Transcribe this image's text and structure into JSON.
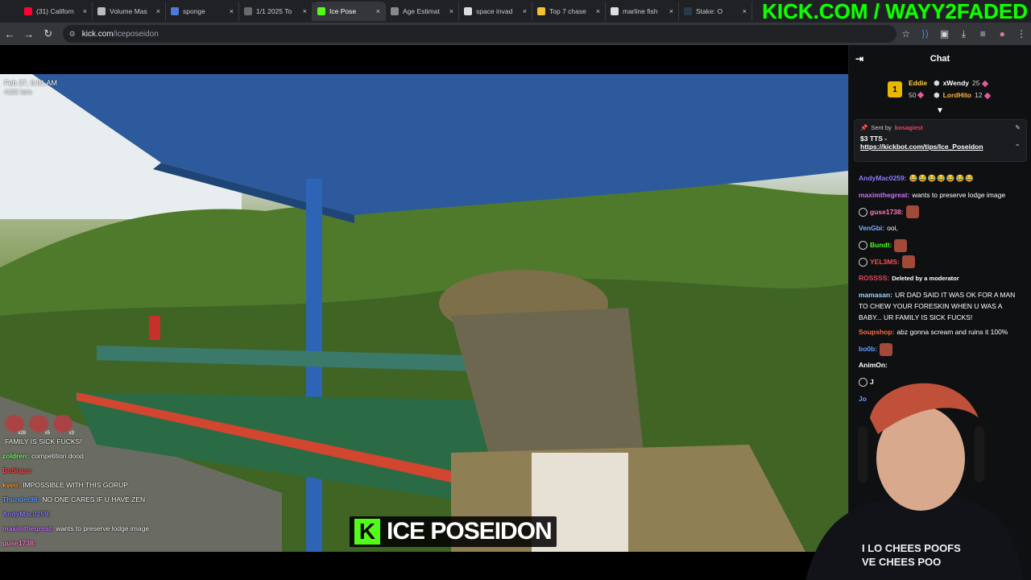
{
  "browser": {
    "tabs": [
      {
        "label": "(31) Californ",
        "color": "#ff0033",
        "active": false
      },
      {
        "label": "Volume Mas",
        "color": "#bbbbbb",
        "active": false
      },
      {
        "label": "sponge",
        "color": "#4a7bd9",
        "active": false
      },
      {
        "label": "1/1 2025 To",
        "color": "#6a6a6a",
        "active": false
      },
      {
        "label": "Ice Pose",
        "color": "#53fc18",
        "active": true
      },
      {
        "label": "Age Estimat",
        "color": "#888888",
        "active": false
      },
      {
        "label": "space invad",
        "color": "#dddddd",
        "active": false
      },
      {
        "label": "Top 7 chase",
        "color": "#f1c232",
        "active": false
      },
      {
        "label": "marline fish",
        "color": "#dddddd",
        "active": false
      },
      {
        "label": "Stake: O",
        "color": "#2a3a4a",
        "active": false
      }
    ],
    "tab_close_glyph": "×",
    "url_host": "kick.com",
    "url_path": "/iceposeidon"
  },
  "stream_overlay_text": "KICK.COM / WAYY2FADED",
  "player": {
    "timestamp": "Feb 27, 6:01 AM",
    "bitrate": "4192 kb/s",
    "streamer_badge_letter": "K",
    "streamer_badge_name": "ICE POSEIDON",
    "overlay_emote_counts": [
      "x28",
      "x5",
      "x3"
    ],
    "overlay_chat": [
      {
        "user": "",
        "color": "#ffffff",
        "text": "FAMILY IS SICK FUCKS!"
      },
      {
        "user": "zoldren:",
        "color": "#7cff6b",
        "text": "competition dood"
      },
      {
        "user": "BoSlaps:",
        "color": "#ff4e4e",
        "text": ""
      },
      {
        "user": "kveo:",
        "color": "#ff9d3b",
        "text": "IMPOSSIBLE WITH THIS GORUP"
      },
      {
        "user": "Thunder98:",
        "color": "#5fa0ff",
        "text": "NO ONE CARES IF U HAVE ZEN"
      },
      {
        "user": "AndyMac0259:",
        "color": "#8c7cff",
        "text": ""
      },
      {
        "user": "maximthegreat:",
        "color": "#c872ff",
        "text": "wants to preserve lodge image"
      },
      {
        "user": "guse1738:",
        "color": "#ff79c6",
        "text": ""
      }
    ]
  },
  "chat": {
    "header_title": "Chat",
    "leaderboard": {
      "rank": "1",
      "first_name": "Eddie",
      "first_value": "50",
      "others": [
        {
          "name": "xWendy",
          "value": "25",
          "color": "#ffffff"
        },
        {
          "name": "LordHito",
          "value": "12",
          "color": "#ffb347"
        }
      ]
    },
    "pinned": {
      "sent_by_label": "Sent by",
      "sender": "bosagiest",
      "tts_line": "$3 TTS -",
      "link": "https://kickbot.com/tips/Ice_Poseidon"
    },
    "messages": [
      {
        "user": "AndyMac0259:",
        "color": "#8c7cff",
        "text": "",
        "emojis": "😂😂😂😂😂😂😂",
        "badge": false,
        "emote": false
      },
      {
        "user": "maximthegreat:",
        "color": "#c872ff",
        "text": "wants to preserve lodge image",
        "emojis": "",
        "badge": false,
        "emote": false
      },
      {
        "user": "guse1738:",
        "color": "#ff79c6",
        "text": "",
        "emojis": "",
        "badge": true,
        "emote": true
      },
      {
        "user": "VenGbi:",
        "color": "#7fb0ff",
        "text": "ooi,",
        "emojis": "",
        "badge": false,
        "emote": false
      },
      {
        "user": "Bundt:",
        "color": "#53fc18",
        "text": "",
        "emojis": "",
        "badge": true,
        "emote": true
      },
      {
        "user": "YEL3MS:",
        "color": "#ff4e4e",
        "text": "",
        "emojis": "",
        "badge": true,
        "emote": true
      },
      {
        "user": "ROSSSS:",
        "color": "#e8435b",
        "text": "Deleted by a moderator",
        "emojis": "",
        "badge": false,
        "emote": false
      },
      {
        "user": "mamasan:",
        "color": "#a4d8ff",
        "text": "UR DAD SAID IT WAS OK FOR A MAN TO CHEW YOUR FORESKIN WHEN U WAS A BABY... UR FAMILY IS SICK FUCKS!",
        "emojis": "",
        "badge": false,
        "emote": false
      },
      {
        "user": "Soupshop:",
        "color": "#ff6b3b",
        "text": "abz gonna scream and ruins it 100%",
        "emojis": "",
        "badge": false,
        "emote": false
      },
      {
        "user": "bo0b:",
        "color": "#5fa0ff",
        "text": "",
        "emojis": "",
        "badge": false,
        "emote": true
      },
      {
        "user": "AnimOn:",
        "color": "#ffffff",
        "text": "",
        "emojis": "",
        "badge": false,
        "emote": false
      },
      {
        "user": "J",
        "color": "#ffffff",
        "text": "",
        "emojis": "",
        "badge": true,
        "emote": false
      },
      {
        "user": "Jo",
        "color": "#5fa0ff",
        "text": "",
        "emojis": "",
        "badge": false,
        "emote": false
      }
    ]
  }
}
